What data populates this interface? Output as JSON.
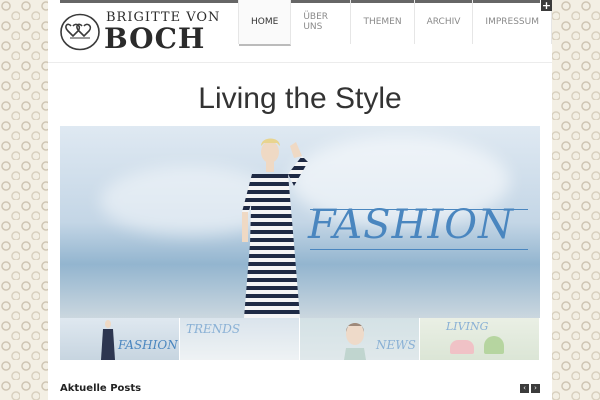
{
  "logo": {
    "line1": "BRIGITTE VON",
    "line2": "BOCH"
  },
  "nav": {
    "items": [
      {
        "label": "HOME",
        "active": true
      },
      {
        "label": "ÜBER UNS",
        "active": false
      },
      {
        "label": "THEMEN",
        "active": false
      },
      {
        "label": "ARCHIV",
        "active": false
      },
      {
        "label": "IMPRESSUM",
        "active": false
      }
    ]
  },
  "page": {
    "title": "Living the Style"
  },
  "hero": {
    "caption": "FASHION",
    "accent": "#4a86bf"
  },
  "slider": {
    "thumbs": [
      {
        "label": "FASHION"
      },
      {
        "label": "TRENDS"
      },
      {
        "label": "NEWS"
      },
      {
        "label": "LIVING"
      }
    ]
  },
  "posts": {
    "title": "Aktuelle Posts"
  },
  "controls": {
    "plus": "+",
    "prev": "‹",
    "next": "›"
  }
}
